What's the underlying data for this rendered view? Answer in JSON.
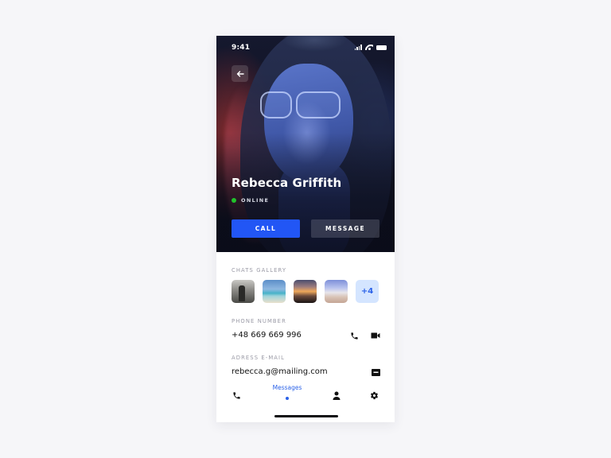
{
  "status_bar": {
    "time": "9:41"
  },
  "profile": {
    "name": "Rebecca Griffith",
    "status": "ONLINE",
    "status_color": "#21c22b"
  },
  "actions": {
    "call_label": "CALL",
    "message_label": "MESSAGE",
    "accent": "#2256f5"
  },
  "gallery": {
    "label": "CHATS GALLERY",
    "thumbnails": [
      {
        "name": "person-on-beach"
      },
      {
        "name": "turquoise-sea"
      },
      {
        "name": "sunset"
      },
      {
        "name": "sandy-shore"
      }
    ],
    "more_label": "+4"
  },
  "phone": {
    "label": "PHONE NUMBER",
    "value": "+48 669 669 996"
  },
  "email": {
    "label": "ADRESS E-MAIL",
    "value": "rebecca.g@mailing.com"
  },
  "bottom_nav": {
    "items": [
      {
        "icon": "phone-icon"
      },
      {
        "label": "Messages",
        "active": true
      },
      {
        "icon": "person-icon"
      },
      {
        "icon": "gear-icon"
      }
    ]
  }
}
